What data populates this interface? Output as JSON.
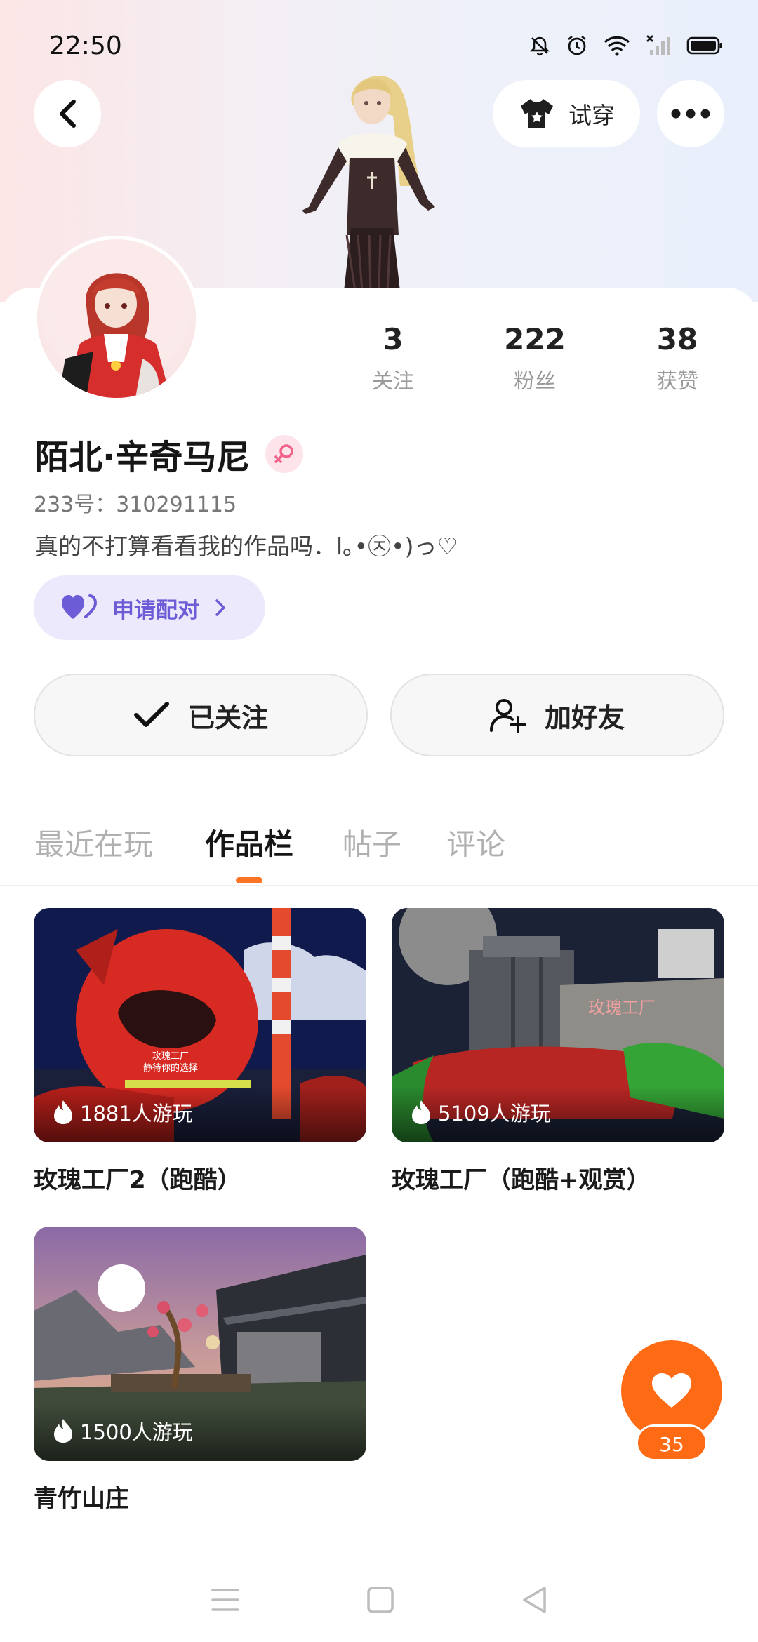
{
  "status_bar": {
    "time": "22:50"
  },
  "header": {
    "try_on_label": "试穿"
  },
  "profile": {
    "name": "陌北·辛奇马尼",
    "user_id": "233号：310291115",
    "bio": "真的不打算看看我的作品吗．l｡•㉨•)っ♡",
    "pair_label": "申请配对",
    "stats": [
      {
        "value": "3",
        "label": "关注"
      },
      {
        "value": "222",
        "label": "粉丝"
      },
      {
        "value": "38",
        "label": "获赞"
      }
    ]
  },
  "actions": {
    "followed_label": "已关注",
    "add_friend_label": "加好友"
  },
  "tabs": [
    {
      "label": "最近在玩",
      "active": false
    },
    {
      "label": "作品栏",
      "active": true
    },
    {
      "label": "帖子",
      "active": false
    },
    {
      "label": "评论",
      "active": false
    }
  ],
  "works": [
    {
      "title": "玫瑰工厂2（跑酷）",
      "plays": "1881人游玩",
      "scene_text": "玫瑰工厂 静待你的选择"
    },
    {
      "title": "玫瑰工厂（跑酷+观赏）",
      "plays": "5109人游玩",
      "scene_text": "玫瑰工厂"
    },
    {
      "title": "青竹山庄",
      "plays": "1500人游玩"
    }
  ],
  "like": {
    "count": "35"
  },
  "colors": {
    "accent": "#ff6a14",
    "pair_bg": "#ebe9fb",
    "pair_text": "#6c5cd6"
  }
}
